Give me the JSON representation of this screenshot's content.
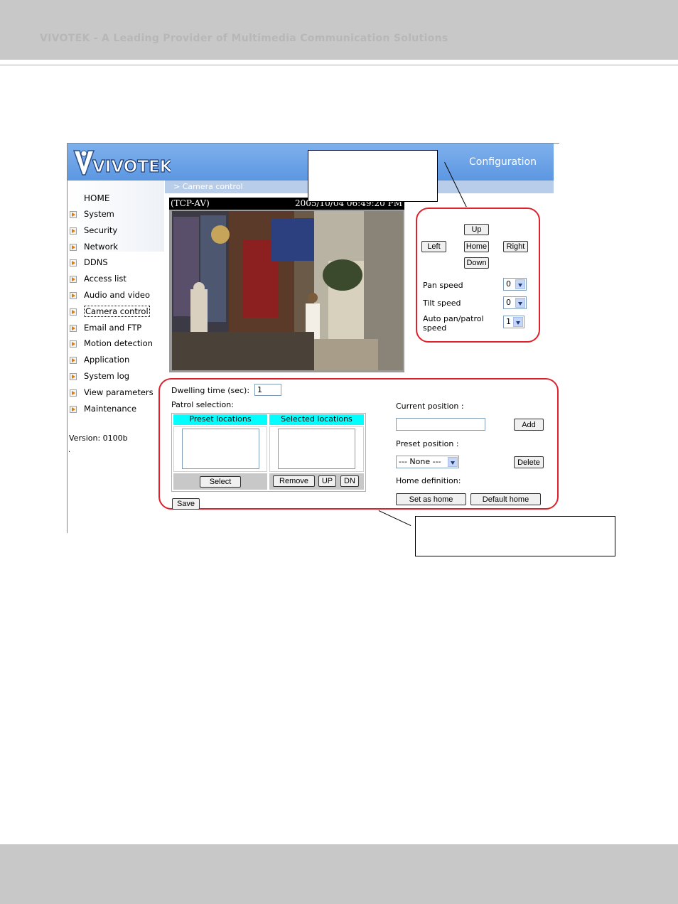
{
  "page_header": "VIVOTEK - A Leading Provider of Multimedia Communication Solutions",
  "app": {
    "logo_text": "VIVOTEK",
    "title": "Configuration",
    "breadcrumb": "> Camera control"
  },
  "sidebar": {
    "home": "HOME",
    "items": [
      "System",
      "Security",
      "Network",
      "DDNS",
      "Access list",
      "Audio and video",
      "Camera control",
      "Email and FTP",
      "Motion detection",
      "Application",
      "System log",
      "View parameters",
      "Maintenance"
    ],
    "version": "Version: 0100b",
    "dot": "."
  },
  "video": {
    "protocol": "(TCP-AV)",
    "timestamp": "2005/10/04 06:49:20 PM"
  },
  "ptz": {
    "up": "Up",
    "left": "Left",
    "home": "Home",
    "right": "Right",
    "down": "Down",
    "pan_speed_label": "Pan speed",
    "pan_speed_value": "0",
    "tilt_speed_label": "Tilt speed",
    "tilt_speed_value": "0",
    "auto_pan_label_1": "Auto pan/patrol",
    "auto_pan_label_2": "speed",
    "auto_pan_value": "1"
  },
  "patrol": {
    "dwelling_label": "Dwelling time (sec):",
    "dwelling_value": "1",
    "selection_label": "Patrol selection:",
    "preset_header": "Preset locations",
    "selected_header": "Selected locations",
    "select_btn": "Select",
    "remove_btn": "Remove",
    "up_btn": "UP",
    "dn_btn": "DN",
    "save_btn": "Save"
  },
  "position": {
    "current_label": "Current position :",
    "current_value": "",
    "add_btn": "Add",
    "preset_label": "Preset position :",
    "preset_value": "--- None ---",
    "delete_btn": "Delete",
    "home_def_label": "Home definition:",
    "set_home_btn": "Set as home",
    "default_home_btn": "Default home"
  },
  "colors": {
    "header_blue": "#5c97e2",
    "annotation_red": "#e0202a",
    "list_header_cyan": "#00ffff"
  }
}
